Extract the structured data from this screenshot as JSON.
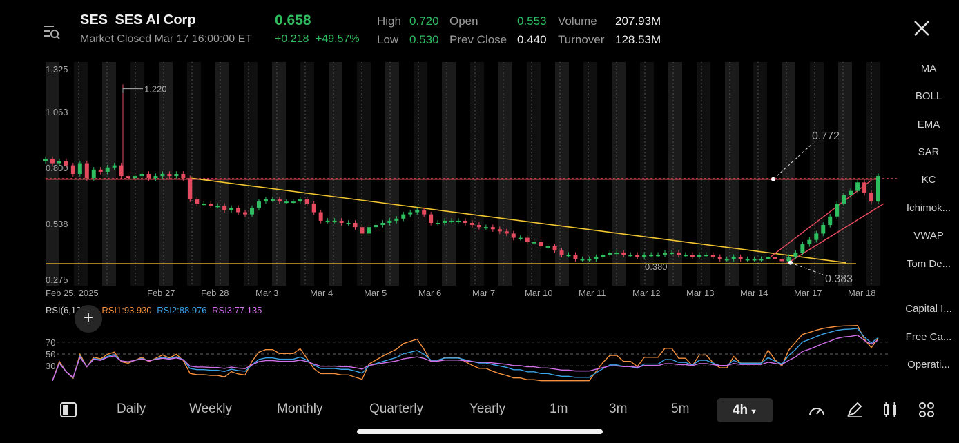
{
  "header": {
    "ticker": "SES",
    "company": "SES AI Corp",
    "status": "Market Closed Mar 17 16:00:00 ET",
    "price": "0.658",
    "change": "+0.218",
    "change_pct": "+49.57%",
    "high_label": "High",
    "high": "0.720",
    "low_label": "Low",
    "low": "0.530",
    "open_label": "Open",
    "open": "0.553",
    "prev_close_label": "Prev Close",
    "prev_close": "0.440",
    "volume_label": "Volume",
    "volume": "207.93M",
    "turnover_label": "Turnover",
    "turnover": "128.53M"
  },
  "indicators": [
    "MA",
    "BOLL",
    "EMA",
    "SAR",
    "KC",
    "Ichimok...",
    "VWAP",
    "Tom De...",
    "Capital I...",
    "Free Ca...",
    "Operati..."
  ],
  "rsi": {
    "title": "RSI(6,12,24)",
    "rsi1": "RSI1:93.930",
    "rsi2": "RSI2:88.976",
    "rsi3": "RSI3:77.135",
    "levels": [
      "70",
      "50",
      "30"
    ]
  },
  "toolbar": {
    "tabs": [
      "Daily",
      "Weekly",
      "Monthly",
      "Quarterly",
      "Yearly",
      "1m",
      "3m",
      "5m"
    ],
    "active": "4h"
  },
  "colors": {
    "up": "#2ebd5f",
    "down": "#e54b5f",
    "trend": "#f2c531",
    "resistance": "#e84a5f",
    "rsi1": "#f5913e",
    "rsi2": "#3aa3e8",
    "rsi3": "#d070e8"
  },
  "chart_data": {
    "type": "candlestick",
    "y_ticks": [
      "1.325",
      "1.063",
      "0.800",
      "0.538",
      "0.275"
    ],
    "x_ticks": [
      "Feb 25, 2025",
      "Feb 27",
      "Feb 28",
      "Mar 3",
      "Mar 4",
      "Mar 5",
      "Mar 6",
      "Mar 7",
      "Mar 10",
      "Mar 11",
      "Mar 12",
      "Mar 13",
      "Mar 14",
      "Mar 17",
      "Mar 18"
    ],
    "ylim": [
      0.275,
      1.325
    ],
    "annotations": [
      "1.220",
      "0.772",
      "0.380",
      "0.383"
    ],
    "closes": [
      0.87,
      0.85,
      0.86,
      0.84,
      0.8,
      0.85,
      0.78,
      0.82,
      0.81,
      0.83,
      0.84,
      0.79,
      0.78,
      0.79,
      0.8,
      0.78,
      0.79,
      0.8,
      0.79,
      0.8,
      0.78,
      0.68,
      0.66,
      0.66,
      0.65,
      0.65,
      0.63,
      0.64,
      0.62,
      0.61,
      0.64,
      0.67,
      0.68,
      0.68,
      0.67,
      0.67,
      0.67,
      0.68,
      0.66,
      0.62,
      0.58,
      0.58,
      0.58,
      0.57,
      0.57,
      0.55,
      0.52,
      0.55,
      0.56,
      0.57,
      0.58,
      0.59,
      0.61,
      0.62,
      0.63,
      0.61,
      0.57,
      0.57,
      0.58,
      0.58,
      0.58,
      0.57,
      0.56,
      0.55,
      0.55,
      0.54,
      0.53,
      0.52,
      0.5,
      0.5,
      0.48,
      0.48,
      0.46,
      0.46,
      0.44,
      0.42,
      0.42,
      0.4,
      0.4,
      0.4,
      0.41,
      0.42,
      0.43,
      0.43,
      0.42,
      0.42,
      0.41,
      0.42,
      0.42,
      0.42,
      0.43,
      0.43,
      0.42,
      0.42,
      0.41,
      0.42,
      0.42,
      0.41,
      0.4,
      0.4,
      0.41,
      0.4,
      0.4,
      0.4,
      0.4,
      0.41,
      0.4,
      0.39,
      0.41,
      0.43,
      0.47,
      0.49,
      0.52,
      0.56,
      0.6,
      0.66,
      0.7,
      0.72,
      0.76,
      0.71,
      0.67,
      0.79
    ]
  }
}
